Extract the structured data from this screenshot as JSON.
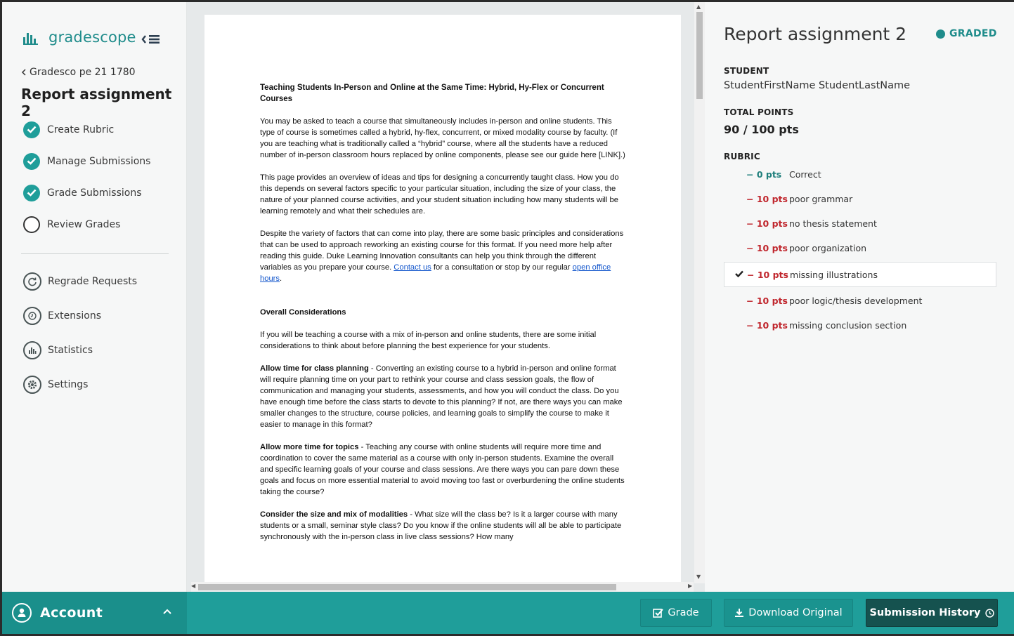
{
  "brand": {
    "name": "gradescope"
  },
  "nav": {
    "back_label": "Gradesco pe 21 1780",
    "assignment_title": "Report assignment 2",
    "steps": [
      {
        "label": "Create Rubric",
        "done": true
      },
      {
        "label": "Manage Submissions",
        "done": true
      },
      {
        "label": "Grade Submissions",
        "done": true
      },
      {
        "label": "Review Grades",
        "done": false
      }
    ],
    "tools": [
      {
        "label": "Regrade Requests",
        "icon": "regrade-icon"
      },
      {
        "label": "Extensions",
        "icon": "clock-icon"
      },
      {
        "label": "Statistics",
        "icon": "bar-chart-icon"
      },
      {
        "label": "Settings",
        "icon": "gear-icon"
      }
    ]
  },
  "document": {
    "heading": "Teaching Students In-Person and Online at the Same Time:  Hybrid, Hy-Flex or Concurrent Courses",
    "p1": "You may be asked to teach a course that simultaneously includes in-person and online students. This type of course is sometimes called a hybrid, hy-flex, concurrent, or mixed modality course by faculty. (If you are teaching what is traditionally called a “hybrid” course, where all the students have a reduced number of in-person classroom hours replaced by online components, please see our guide here [LINK].)",
    "p2": "This page provides an overview of ideas and tips for designing a concurrently taught class. How you do this depends on several factors specific to your particular situation, including the size of your class, the nature of your planned course activities, and your student situation including how many students will be learning remotely and what their schedules are.",
    "p3_pre": "Despite the variety of factors that can come into play, there are some basic principles and considerations that can be used to approach reworking an existing course for this format. If you need more help after reading this guide. Duke Learning Innovation consultants can help you think through the different variables as you prepare your course. ",
    "p3_link1": "Contact us",
    "p3_mid": " for a consultation or stop by our regular ",
    "p3_link2": "open office hours",
    "p3_end": ".",
    "section": "Overall Considerations",
    "p4": "If you will be teaching a course with a mix of in-person and online students, there are some initial considerations to think about before planning the best experience for your students.",
    "p5_bold": "Allow time for class planning",
    "p5": " - Converting an existing course to a hybrid in-person and online format will require planning time on your part to rethink your course and class session goals, the flow of communication and managing your students, assessments, and how you will conduct the class. Do you have enough time before the class starts to devote to this planning?  If not, are there ways you can make smaller changes to the structure, course policies, and learning goals to simplify the course to make it easier to manage in this format?",
    "p6_bold": "Allow more time for topics",
    "p6": " - Teaching any course with online students will require more time and coordination to cover the same material as a course with only in-person students. Examine the overall and specific learning goals of your course and class sessions. Are there ways you can pare down these goals and focus on more essential material to avoid moving too fast or overburdening the online students taking the course?",
    "p7_bold": "Consider the size and mix of modalities",
    "p7": " - What size will the class be?  Is it a larger course with many students or a small, seminar style class?  Do you know if the online students will all be able to participate synchronously with the in-person class in live class sessions?  How many"
  },
  "panel": {
    "title": "Report assignment 2",
    "status": "GRADED",
    "student_label": "STUDENT",
    "student_name": "StudentFirstName StudentLastName",
    "points_label": "TOTAL POINTS",
    "points_value": "90 / 100 pts",
    "rubric_label": "RUBRIC",
    "rubric": [
      {
        "score": "− 0 pts",
        "label": "Correct",
        "selected": false,
        "kind": "zero"
      },
      {
        "score": "− 10 pts",
        "label": "poor grammar",
        "selected": false,
        "kind": "neg"
      },
      {
        "score": "− 10 pts",
        "label": "no thesis statement",
        "selected": false,
        "kind": "neg"
      },
      {
        "score": "− 10 pts",
        "label": "poor organization",
        "selected": false,
        "kind": "neg"
      },
      {
        "score": "− 10 pts",
        "label": "missing illustrations",
        "selected": true,
        "kind": "neg"
      },
      {
        "score": "− 10 pts",
        "label": "poor logic/thesis development",
        "selected": false,
        "kind": "neg"
      },
      {
        "score": "− 10 pts",
        "label": "missing conclusion section",
        "selected": false,
        "kind": "neg"
      }
    ]
  },
  "footer": {
    "account_label": "Account",
    "grade_label": "Grade",
    "download_label": "Download Original",
    "history_label": "Submission History"
  },
  "colors": {
    "brand": "#1f9e9a",
    "deduction": "#c0262d",
    "dark_button": "#15524f"
  }
}
